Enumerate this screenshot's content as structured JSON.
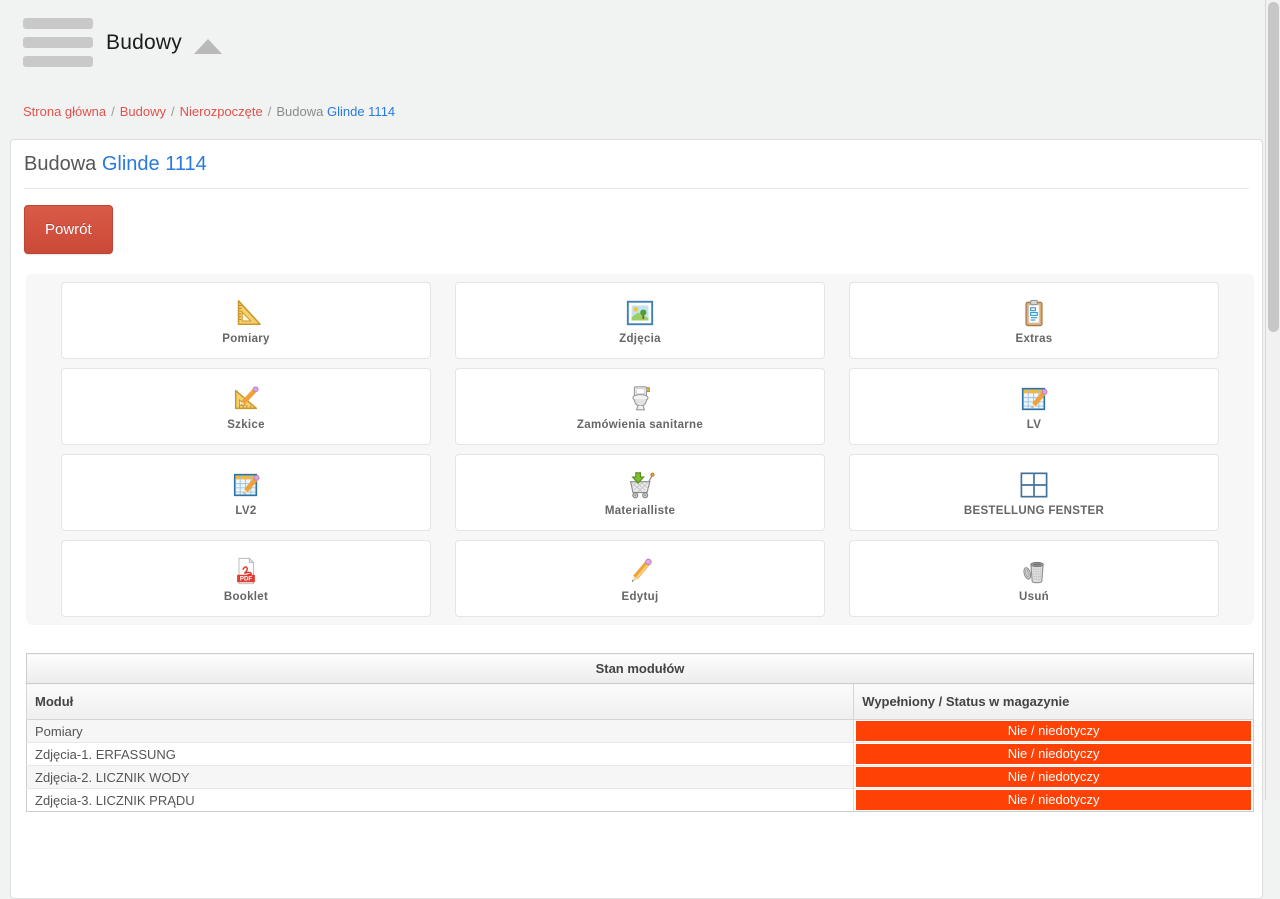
{
  "header": {
    "title": "Budowy",
    "menu_icon": "hamburger-icon",
    "collapse_icon": "triangle-up-icon"
  },
  "breadcrumb": {
    "separator": "/",
    "items": [
      {
        "label": "Strona główna"
      },
      {
        "label": "Budowy"
      },
      {
        "label": "Nierozpoczęte"
      },
      {
        "label": "Budowa"
      },
      {
        "label": "Glinde 1114"
      }
    ]
  },
  "page": {
    "title_prefix": "Budowa",
    "title_link": "Glinde 1114",
    "back_button": "Powrót"
  },
  "tiles": [
    {
      "label": "Pomiary",
      "icon": "set-square-icon"
    },
    {
      "label": "Zdjęcia",
      "icon": "photo-icon"
    },
    {
      "label": "Extras",
      "icon": "clipboard-icon"
    },
    {
      "label": "Szkice",
      "icon": "ruler-pencil-icon"
    },
    {
      "label": "Zamówienia sanitarne",
      "icon": "toilet-icon"
    },
    {
      "label": "LV",
      "icon": "spreadsheet-pencil-icon"
    },
    {
      "label": "LV2",
      "icon": "spreadsheet-pencil-icon"
    },
    {
      "label": "Materialliste",
      "icon": "cart-download-icon"
    },
    {
      "label": "BESTELLUNG FENSTER",
      "icon": "window-icon"
    },
    {
      "label": "Booklet",
      "icon": "pdf-icon"
    },
    {
      "label": "Edytuj",
      "icon": "pencil-icon"
    },
    {
      "label": "Usuń",
      "icon": "trash-icon"
    }
  ],
  "module_table": {
    "caption": "Stan modułów",
    "columns": [
      "Moduł",
      "Wypełniony / Status w magazynie"
    ],
    "rows": [
      {
        "module": "Pomiary",
        "status": "Nie / niedotyczy"
      },
      {
        "module": "Zdjęcia-1. ERFASSUNG",
        "status": "Nie / niedotyczy"
      },
      {
        "module": "Zdjęcia-2. LICZNIK WODY",
        "status": "Nie / niedotyczy"
      },
      {
        "module": "Zdjęcia-3. LICZNIK PRĄDU",
        "status": "Nie / niedotyczy"
      }
    ]
  },
  "colors": {
    "status_badge": "#ff4106",
    "back_button": "#d0513f",
    "breadcrumb_link": "#e2524c",
    "blue_link": "#2a7ade"
  }
}
